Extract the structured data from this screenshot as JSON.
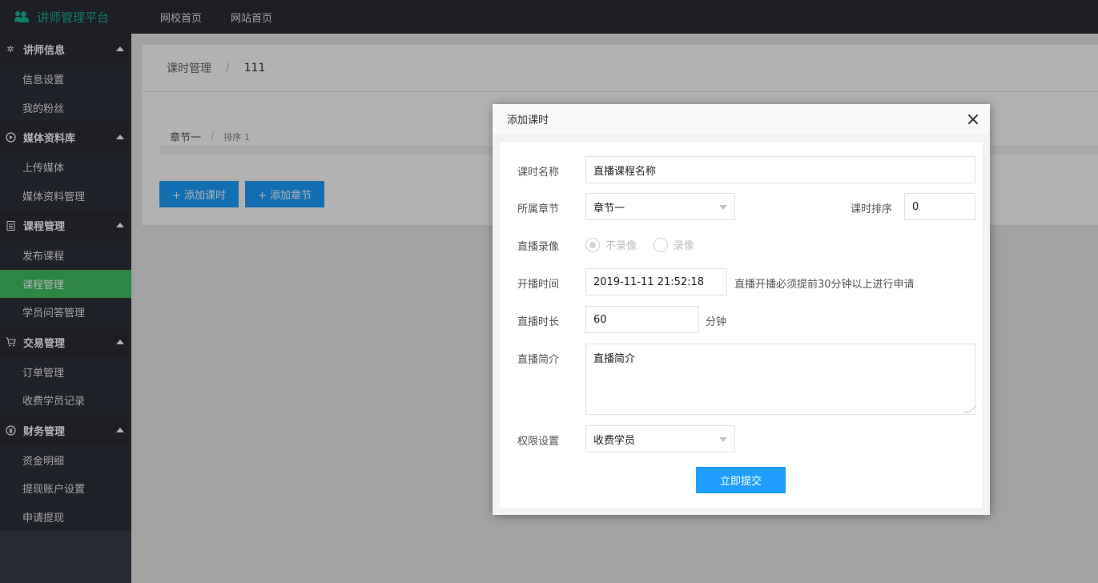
{
  "app": {
    "title": "讲师管理平台",
    "icon": "users-icon"
  },
  "topnav": [
    "网校首页",
    "网站首页"
  ],
  "sidebar": {
    "groups": [
      {
        "label": "讲师信息",
        "icon": "gear-icon",
        "items": [
          {
            "label": "信息设置"
          },
          {
            "label": "我的粉丝"
          }
        ]
      },
      {
        "label": "媒体资料库",
        "icon": "play-circle-icon",
        "items": [
          {
            "label": "上传媒体"
          },
          {
            "label": "媒体资料管理"
          }
        ]
      },
      {
        "label": "课程管理",
        "icon": "document-icon",
        "items": [
          {
            "label": "发布课程"
          },
          {
            "label": "课程管理",
            "active": true
          },
          {
            "label": "学员问答管理"
          }
        ]
      },
      {
        "label": "交易管理",
        "icon": "cart-icon",
        "items": [
          {
            "label": "订单管理"
          },
          {
            "label": "收费学员记录"
          }
        ]
      },
      {
        "label": "财务管理",
        "icon": "yen-circle-icon",
        "items": [
          {
            "label": "资金明细"
          },
          {
            "label": "提现账户设置"
          },
          {
            "label": "申请提现"
          }
        ]
      }
    ]
  },
  "breadcrumb": {
    "parent": "课时管理",
    "separator": "/",
    "current": "111"
  },
  "chapter": {
    "name": "章节一",
    "separator": "/",
    "sort_text": "排序 1"
  },
  "actions": {
    "add_lesson": "+ 添加课时",
    "add_chapter": "+ 添加章节"
  },
  "dialog": {
    "title": "添加课时",
    "fields": {
      "lesson_name": {
        "label": "课时名称",
        "value": "直播课程名称"
      },
      "chapter": {
        "label": "所属章节",
        "value": "章节一"
      },
      "sort": {
        "label": "课时排序",
        "value": "0"
      },
      "recording": {
        "label": "直播录像",
        "options": [
          "不录像",
          "录像"
        ],
        "selected": "不录像"
      },
      "start_time": {
        "label": "开播时间",
        "value": "2019-11-11 21:52:18",
        "hint": "直播开播必须提前30分钟以上进行申请"
      },
      "duration": {
        "label": "直播时长",
        "value": "60",
        "unit": "分钟"
      },
      "intro": {
        "label": "直播简介",
        "value": "直播简介"
      },
      "permission": {
        "label": "权限设置",
        "value": "收费学员"
      }
    },
    "submit": "立即提交"
  },
  "colors": {
    "topbar": "#2a2d35",
    "sidebar": "#393d49",
    "active": "#41c05f",
    "primary": "#1e9fff",
    "brand": "#18b49a"
  }
}
